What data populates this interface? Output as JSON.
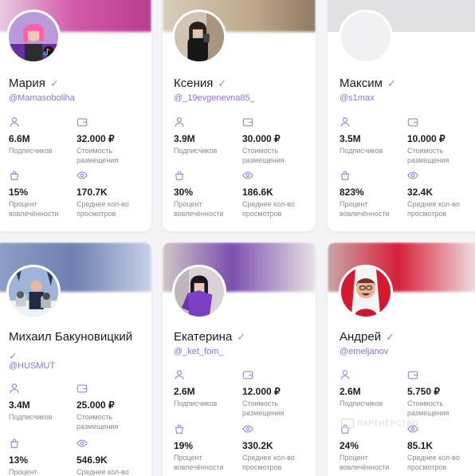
{
  "labels": {
    "subscribers": "Подписчиков",
    "cost": "Стоимость\nразмещения",
    "engagement": "Процент\nвовлечённости",
    "views": "Среднее кол-во\nпросмотров"
  },
  "verified_mark": "✓",
  "watermark": "ПАРТНЁРСТВО",
  "bloggers": [
    {
      "name": "Мария",
      "handle": "@Mamasoboliha",
      "subscribers": "6.6M",
      "cost": "32.000 ₽",
      "engagement": "15%",
      "views": "170.7K"
    },
    {
      "name": "Ксения",
      "handle": "@_19evgenevna85_",
      "subscribers": "3.9M",
      "cost": "30.000 ₽",
      "engagement": "30%",
      "views": "186.6K"
    },
    {
      "name": "Максим",
      "handle": "@s1max",
      "subscribers": "3.5M",
      "cost": "10.000 ₽",
      "engagement": "823%",
      "views": "32.4K"
    },
    {
      "name": "Михаил Бакуновицкий",
      "handle": "@HUSMUT",
      "subscribers": "3.4M",
      "cost": "25.000 ₽",
      "engagement": "13%",
      "views": "546.9K"
    },
    {
      "name": "Екатерина",
      "handle": "@_ket_fom_",
      "subscribers": "2.6M",
      "cost": "12.000 ₽",
      "engagement": "19%",
      "views": "330.2K"
    },
    {
      "name": "Андрей",
      "handle": "@emeljanov",
      "subscribers": "2.6M",
      "cost": "5.750 ₽",
      "engagement": "24%",
      "views": "85.1K"
    }
  ],
  "colors": {
    "accent": "#8e73d6",
    "icon": "#9d86d8",
    "muted": "#8a8a8f"
  }
}
